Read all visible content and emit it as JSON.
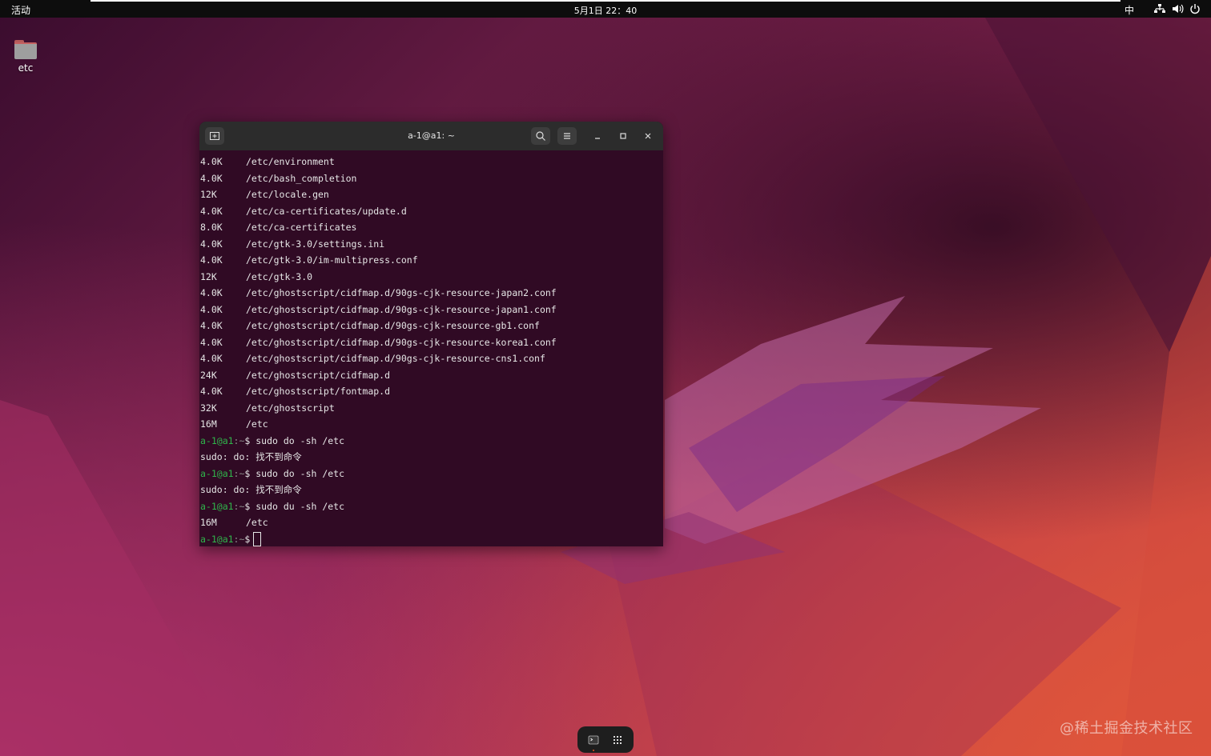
{
  "top_bar": {
    "activities": "活动",
    "datetime": "5月1日 22：40",
    "input_method": "中",
    "icons": [
      "network-icon",
      "volume-icon",
      "power-icon"
    ]
  },
  "desktop": {
    "icons": [
      {
        "label": "etc",
        "icon": "folder-icon"
      }
    ]
  },
  "terminal": {
    "title": "a-1@a1: ~",
    "header_buttons": [
      "new-tab-icon",
      "search-icon",
      "menu-icon",
      "minimize-icon",
      "maximize-icon",
      "close-icon"
    ],
    "output": [
      {
        "size": "4.0K",
        "path": "/etc/environment"
      },
      {
        "size": "4.0K",
        "path": "/etc/bash_completion"
      },
      {
        "size": "12K",
        "path": "/etc/locale.gen"
      },
      {
        "size": "4.0K",
        "path": "/etc/ca-certificates/update.d"
      },
      {
        "size": "8.0K",
        "path": "/etc/ca-certificates"
      },
      {
        "size": "4.0K",
        "path": "/etc/gtk-3.0/settings.ini"
      },
      {
        "size": "4.0K",
        "path": "/etc/gtk-3.0/im-multipress.conf"
      },
      {
        "size": "12K",
        "path": "/etc/gtk-3.0"
      },
      {
        "size": "4.0K",
        "path": "/etc/ghostscript/cidfmap.d/90gs-cjk-resource-japan2.conf"
      },
      {
        "size": "4.0K",
        "path": "/etc/ghostscript/cidfmap.d/90gs-cjk-resource-japan1.conf"
      },
      {
        "size": "4.0K",
        "path": "/etc/ghostscript/cidfmap.d/90gs-cjk-resource-gb1.conf"
      },
      {
        "size": "4.0K",
        "path": "/etc/ghostscript/cidfmap.d/90gs-cjk-resource-korea1.conf"
      },
      {
        "size": "4.0K",
        "path": "/etc/ghostscript/cidfmap.d/90gs-cjk-resource-cns1.conf"
      },
      {
        "size": "24K",
        "path": "/etc/ghostscript/cidfmap.d"
      },
      {
        "size": "4.0K",
        "path": "/etc/ghostscript/fontmap.d"
      },
      {
        "size": "32K",
        "path": "/etc/ghostscript"
      },
      {
        "size": "16M",
        "path": "/etc"
      }
    ],
    "session": [
      {
        "type": "prompt",
        "user": "a-1@a1",
        "sep": ":~",
        "cmd": "$ sudo do -sh /etc"
      },
      {
        "type": "text",
        "text": "sudo: do: 找不到命令"
      },
      {
        "type": "prompt",
        "user": "a-1@a1",
        "sep": ":~",
        "cmd": "$ sudo do -sh /etc"
      },
      {
        "type": "text",
        "text": "sudo: do: 找不到命令"
      },
      {
        "type": "prompt",
        "user": "a-1@a1",
        "sep": ":~",
        "cmd": "$ sudo du -sh /etc"
      },
      {
        "type": "output",
        "size": "16M",
        "path": "/etc"
      },
      {
        "type": "prompt",
        "user": "a-1@a1",
        "sep": ":~",
        "cmd": "$",
        "cursor": true
      }
    ]
  },
  "dock": {
    "items": [
      "terminal-icon",
      "app-grid-icon"
    ]
  },
  "watermark": "@稀土掘金技术社区",
  "colors": {
    "terminal_bg": "#300a24",
    "prompt_user": "#2fb54b",
    "header_bg": "#2c2c2c",
    "top_bar": "#0d0d0d"
  }
}
